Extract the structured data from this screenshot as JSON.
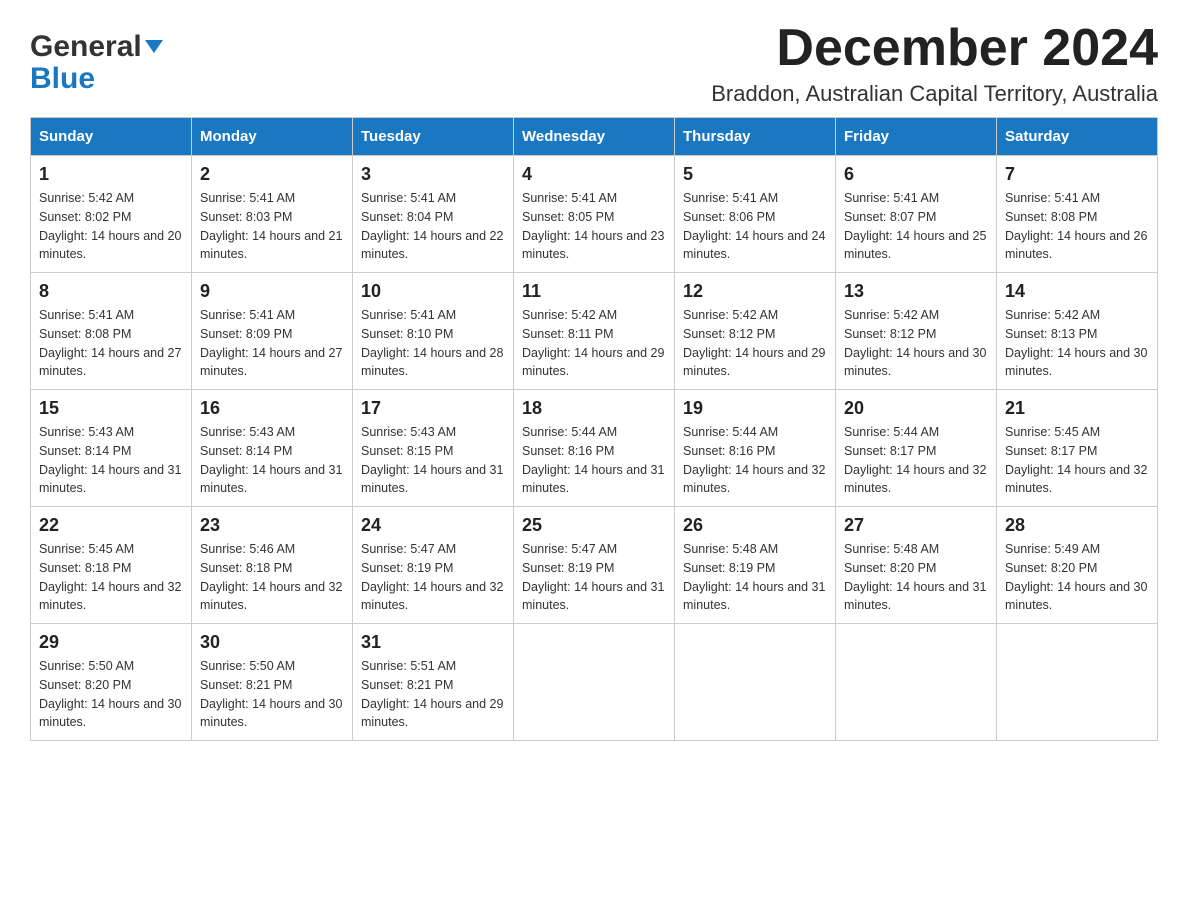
{
  "logo": {
    "general": "General",
    "blue": "Blue"
  },
  "title": "December 2024",
  "location": "Braddon, Australian Capital Territory, Australia",
  "headers": [
    "Sunday",
    "Monday",
    "Tuesday",
    "Wednesday",
    "Thursday",
    "Friday",
    "Saturday"
  ],
  "weeks": [
    [
      {
        "day": "1",
        "sunrise": "5:42 AM",
        "sunset": "8:02 PM",
        "daylight": "14 hours and 20 minutes."
      },
      {
        "day": "2",
        "sunrise": "5:41 AM",
        "sunset": "8:03 PM",
        "daylight": "14 hours and 21 minutes."
      },
      {
        "day": "3",
        "sunrise": "5:41 AM",
        "sunset": "8:04 PM",
        "daylight": "14 hours and 22 minutes."
      },
      {
        "day": "4",
        "sunrise": "5:41 AM",
        "sunset": "8:05 PM",
        "daylight": "14 hours and 23 minutes."
      },
      {
        "day": "5",
        "sunrise": "5:41 AM",
        "sunset": "8:06 PM",
        "daylight": "14 hours and 24 minutes."
      },
      {
        "day": "6",
        "sunrise": "5:41 AM",
        "sunset": "8:07 PM",
        "daylight": "14 hours and 25 minutes."
      },
      {
        "day": "7",
        "sunrise": "5:41 AM",
        "sunset": "8:08 PM",
        "daylight": "14 hours and 26 minutes."
      }
    ],
    [
      {
        "day": "8",
        "sunrise": "5:41 AM",
        "sunset": "8:08 PM",
        "daylight": "14 hours and 27 minutes."
      },
      {
        "day": "9",
        "sunrise": "5:41 AM",
        "sunset": "8:09 PM",
        "daylight": "14 hours and 27 minutes."
      },
      {
        "day": "10",
        "sunrise": "5:41 AM",
        "sunset": "8:10 PM",
        "daylight": "14 hours and 28 minutes."
      },
      {
        "day": "11",
        "sunrise": "5:42 AM",
        "sunset": "8:11 PM",
        "daylight": "14 hours and 29 minutes."
      },
      {
        "day": "12",
        "sunrise": "5:42 AM",
        "sunset": "8:12 PM",
        "daylight": "14 hours and 29 minutes."
      },
      {
        "day": "13",
        "sunrise": "5:42 AM",
        "sunset": "8:12 PM",
        "daylight": "14 hours and 30 minutes."
      },
      {
        "day": "14",
        "sunrise": "5:42 AM",
        "sunset": "8:13 PM",
        "daylight": "14 hours and 30 minutes."
      }
    ],
    [
      {
        "day": "15",
        "sunrise": "5:43 AM",
        "sunset": "8:14 PM",
        "daylight": "14 hours and 31 minutes."
      },
      {
        "day": "16",
        "sunrise": "5:43 AM",
        "sunset": "8:14 PM",
        "daylight": "14 hours and 31 minutes."
      },
      {
        "day": "17",
        "sunrise": "5:43 AM",
        "sunset": "8:15 PM",
        "daylight": "14 hours and 31 minutes."
      },
      {
        "day": "18",
        "sunrise": "5:44 AM",
        "sunset": "8:16 PM",
        "daylight": "14 hours and 31 minutes."
      },
      {
        "day": "19",
        "sunrise": "5:44 AM",
        "sunset": "8:16 PM",
        "daylight": "14 hours and 32 minutes."
      },
      {
        "day": "20",
        "sunrise": "5:44 AM",
        "sunset": "8:17 PM",
        "daylight": "14 hours and 32 minutes."
      },
      {
        "day": "21",
        "sunrise": "5:45 AM",
        "sunset": "8:17 PM",
        "daylight": "14 hours and 32 minutes."
      }
    ],
    [
      {
        "day": "22",
        "sunrise": "5:45 AM",
        "sunset": "8:18 PM",
        "daylight": "14 hours and 32 minutes."
      },
      {
        "day": "23",
        "sunrise": "5:46 AM",
        "sunset": "8:18 PM",
        "daylight": "14 hours and 32 minutes."
      },
      {
        "day": "24",
        "sunrise": "5:47 AM",
        "sunset": "8:19 PM",
        "daylight": "14 hours and 32 minutes."
      },
      {
        "day": "25",
        "sunrise": "5:47 AM",
        "sunset": "8:19 PM",
        "daylight": "14 hours and 31 minutes."
      },
      {
        "day": "26",
        "sunrise": "5:48 AM",
        "sunset": "8:19 PM",
        "daylight": "14 hours and 31 minutes."
      },
      {
        "day": "27",
        "sunrise": "5:48 AM",
        "sunset": "8:20 PM",
        "daylight": "14 hours and 31 minutes."
      },
      {
        "day": "28",
        "sunrise": "5:49 AM",
        "sunset": "8:20 PM",
        "daylight": "14 hours and 30 minutes."
      }
    ],
    [
      {
        "day": "29",
        "sunrise": "5:50 AM",
        "sunset": "8:20 PM",
        "daylight": "14 hours and 30 minutes."
      },
      {
        "day": "30",
        "sunrise": "5:50 AM",
        "sunset": "8:21 PM",
        "daylight": "14 hours and 30 minutes."
      },
      {
        "day": "31",
        "sunrise": "5:51 AM",
        "sunset": "8:21 PM",
        "daylight": "14 hours and 29 minutes."
      },
      null,
      null,
      null,
      null
    ]
  ],
  "labels": {
    "sunrise": "Sunrise:",
    "sunset": "Sunset:",
    "daylight": "Daylight:"
  }
}
